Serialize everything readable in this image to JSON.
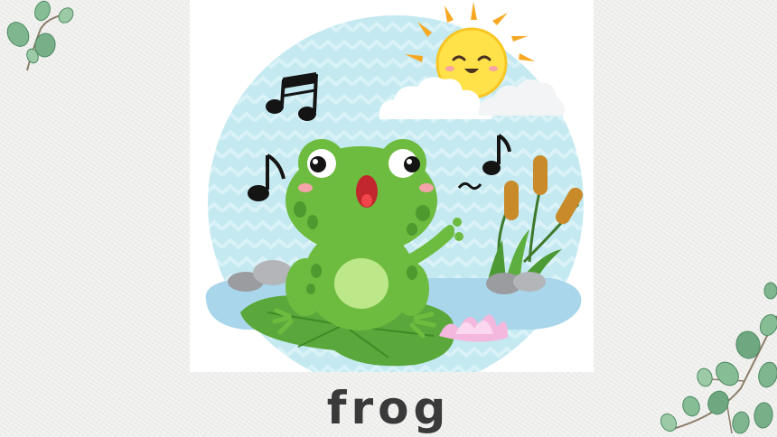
{
  "slide": {
    "word": "frog",
    "background_color": "#eeeeec",
    "text_color": "#3a3a3a"
  },
  "illustration": {
    "subject": "frog",
    "icons": [
      "frog-icon",
      "sun-icon",
      "cloud-icon",
      "music-note-icon",
      "cattail-icon",
      "water-lily-icon",
      "lily-pad-icon",
      "rock-icon",
      "leaf-branch-icon"
    ],
    "colors": {
      "sky_circle": "#bfe7ef",
      "frog_green": "#6dbb3f",
      "frog_belly": "#bde88a",
      "sun_yellow": "#ffe14a",
      "sun_rays": "#f7a823",
      "lily_pad": "#5aa83b",
      "water": "#a9d6ea",
      "lotus_pink": "#f4b8df",
      "cattail_brown": "#c98a2a",
      "leaf_green": "#7fb58f"
    }
  }
}
